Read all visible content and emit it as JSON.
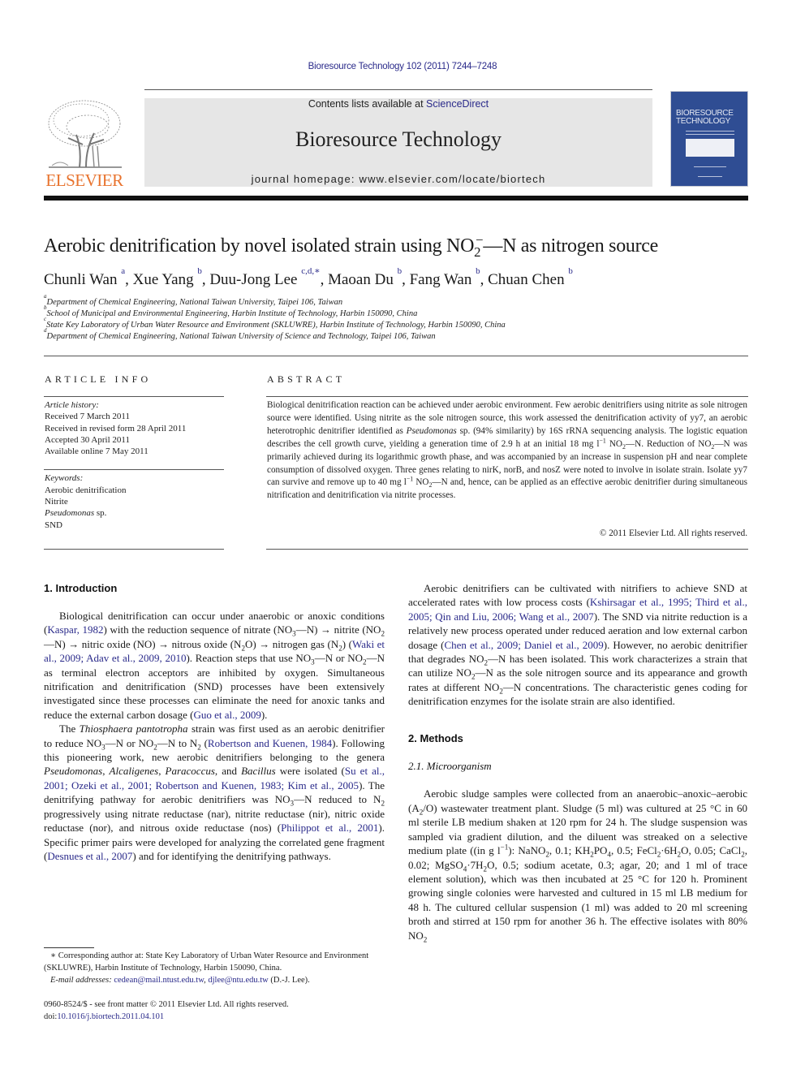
{
  "header": {
    "citation": "Bioresource Technology 102 (2011) 7244–7248",
    "contents_prefix": "Contents lists available at ",
    "contents_link": "ScienceDirect",
    "journal_name": "Bioresource Technology",
    "homepage": "journal homepage: www.elsevier.com/locate/biortech",
    "publisher_logo_text": "ELSEVIER",
    "cover_title_line1": "BIORESOURCE",
    "cover_title_line2": "TECHNOLOGY",
    "colors": {
      "publisher_orange": "#e8732e",
      "link_blue": "#2a2a8a",
      "masthead_gray": "#e6e6e6",
      "cover_blue": "#2f4d93"
    }
  },
  "article": {
    "title_pre": "Aerobic denitrification by novel isolated strain using NO",
    "title_sub": "2",
    "title_sup": "−",
    "title_post": "—N as nitrogen source",
    "authors": [
      {
        "name": "Chunli Wan",
        "aff": "a"
      },
      {
        "name": "Xue Yang",
        "aff": "b"
      },
      {
        "name": "Duu-Jong Lee",
        "aff": "c,d,∗"
      },
      {
        "name": "Maoan Du",
        "aff": "b"
      },
      {
        "name": "Fang Wan",
        "aff": "b"
      },
      {
        "name": "Chuan Chen",
        "aff": "b"
      }
    ],
    "affiliations": [
      {
        "mark": "a",
        "text": "Department of Chemical Engineering, National Taiwan University, Taipei 106, Taiwan"
      },
      {
        "mark": "b",
        "text": "School of Municipal and Environmental Engineering, Harbin Institute of Technology, Harbin 150090, China"
      },
      {
        "mark": "c",
        "text": "State Key Laboratory of Urban Water Resource and Environment (SKLUWRE), Harbin Institute of Technology, Harbin 150090, China"
      },
      {
        "mark": "d",
        "text": "Department of Chemical Engineering, National Taiwan University of Science and Technology, Taipei 106, Taiwan"
      }
    ]
  },
  "article_info": {
    "heading": "ARTICLE INFO",
    "history_label": "Article history:",
    "history": [
      "Received 7 March 2011",
      "Received in revised form 28 April 2011",
      "Accepted 30 April 2011",
      "Available online 7 May 2011"
    ],
    "keywords_label": "Keywords:",
    "keywords": [
      "Aerobic denitrification",
      "Nitrite",
      "Pseudomonas",
      "SND"
    ],
    "keyword_3_suffix": " sp."
  },
  "abstract": {
    "heading": "ABSTRACT",
    "p1": "Biological denitrification reaction can be achieved under aerobic environment. Few aerobic denitrifiers using nitrite as sole nitrogen source were identified. Using nitrite as the sole nitrogen source, this work assessed the denitrification activity of yy7, an aerobic heterotrophic denitrifier identified as ",
    "p1_italic": "Pseudomonas",
    "p2": " sp. (94% similarity) by 16S rRNA sequencing analysis. The logistic equation describes the cell growth curve, yielding a generation time of 2.9 h at an initial 18 mg l",
    "p3": " NO",
    "p4": "—N. Reduction of NO",
    "p5": "—N was primarily achieved during its logarithmic growth phase, and was accompanied by an increase in suspension pH and near complete consumption of dissolved oxygen. Three genes relating to nirK, norB, and nosZ were noted to involve in isolate strain. Isolate yy7 can survive and remove up to 40 mg l",
    "p6": " NO",
    "p7": "—N and, hence, can be applied as an effective aerobic denitrifier during simultaneous nitrification and denitrification via nitrite processes.",
    "sup_minus1": "−1",
    "sub2": "2",
    "supminus": "−",
    "copyright": "© 2011 Elsevier Ltd. All rights reserved."
  },
  "intro": {
    "heading": "1. Introduction",
    "p1": {
      "a": "Biological denitrification can occur under anaerobic or anoxic conditions (",
      "l1": "Kaspar, 1982",
      "b": ") with the reduction sequence of nitrate (NO",
      "c": "—N) → nitrite (NO",
      "d": "—N) → nitric oxide (NO) → nitrous oxide (N",
      "e": "O) → nitrogen gas (N",
      "f": ") (",
      "l2": "Waki et al., 2009; Adav et al., 2009, 2010",
      "g": "). Reaction steps that use NO",
      "h": "—N or NO",
      "i": "—N as terminal electron acceptors are inhibited by oxygen. Simultaneous nitrification and denitrification (SND) processes have been extensively investigated since these processes can eliminate the need for anoxic tanks and reduce the external carbon dosage (",
      "l3": "Guo et al., 2009",
      "j": ")."
    },
    "p2": {
      "a": "The ",
      "it1": "Thiosphaera pantotropha",
      "b": " strain was first used as an aerobic denitrifier to reduce NO",
      "c": "—N or NO",
      "d": "—N to N",
      "e": " (",
      "l1": "Robertson and Kuenen, 1984",
      "f": "). Following this pioneering work, new aerobic denitrifiers belonging to the genera ",
      "it2": "Pseudomonas",
      "g": ", ",
      "it3": "Alcaligenes",
      "h": ", ",
      "it4": "Paracoccus",
      "i": ", and ",
      "it5": "Bacillus",
      "j": " were isolated (",
      "l2": "Su et al., 2001; Ozeki et al., 2001; Robertson and Kuenen, 1983; Kim et al., 2005",
      "k": "). The denitrifying pathway for aerobic denitrifiers was NO",
      "l": "—N reduced to N",
      "m": " progressively using nitrate reductase (nar), nitrite reductase (nir), nitric oxide reductase (nor), and nitrous oxide reductase (nos) (",
      "l3": "Philippot et al., 2001",
      "n": "). Specific primer pairs were developed for analyzing the correlated gene fragment (",
      "l4": "Desnues et al., 2007",
      "o": ") and for identifying the denitrifying pathways."
    },
    "sub2": "2",
    "sub3": "3",
    "supminus": "−"
  },
  "col2": {
    "p1": {
      "a": "Aerobic denitrifiers can be cultivated with nitrifiers to achieve SND at accelerated rates with low process costs (",
      "l1": "Kshirsagar et al., 1995; Third et al., 2005; Qin and Liu, 2006; Wang et al., 2007",
      "b": "). The SND via nitrite reduction is a relatively new process operated under reduced aeration and low external carbon dosage (",
      "l2": "Chen et al., 2009; Daniel et al., 2009",
      "c": "). However, no aerobic denitrifier that degrades NO",
      "d": "—N has been isolated. This work characterizes a strain that can utilize NO",
      "e": "—N as the sole nitrogen source and its appearance and growth rates at different NO",
      "f": "—N concentrations. The characteristic genes coding for denitrification enzymes for the isolate strain are also identified."
    },
    "methods_heading": "2. Methods",
    "sub_heading": "2.1. Microorganism",
    "p2": {
      "a": "Aerobic sludge samples were collected from an anaerobic–anoxic–aerobic (A",
      "b": "/O) wastewater treatment plant. Sludge (5 ml) was cultured at 25 °C in 60 ml sterile LB medium shaken at 120 rpm for 24 h. The sludge suspension was sampled via gradient dilution, and the diluent was streaked on a selective medium plate ((in g l",
      "c": "): NaNO",
      "d": ", 0.1; KH",
      "e": "PO",
      "f": ", 0.5; FeCl",
      "g": "·6H",
      "h": "O, 0.05; CaCl",
      "i": ", 0.02; MgSO",
      "j": "·7H",
      "k": "O, 0.5; sodium acetate, 0.3; agar, 20; and 1 ml of trace element solution), which was then incubated at 25 °C for 120 h. Prominent growing single colonies were harvested and cultured in 15 ml LB medium for 48 h. The cultured cellular suspension (1 ml) was added to 20 ml screening broth and stirred at 150 rpm for another 36 h. The effective isolates with 80% NO"
    },
    "sub4": "4",
    "supm1": "−1"
  },
  "footnote": {
    "corresponding": "∗ Corresponding author at: State Key Laboratory of Urban Water Resource and Environment (SKLUWRE), Harbin Institute of Technology, Harbin 150090, China.",
    "email_label": "E-mail addresses:",
    "email1": "cedean@mail.ntust.edu.tw",
    "email2": "djlee@ntu.edu.tw",
    "email_suffix": " (D.-J. Lee).",
    "issn_line": "0960-8524/$ - see front matter © 2011 Elsevier Ltd. All rights reserved.",
    "doi_label": "doi:",
    "doi": "10.1016/j.biortech.2011.04.101"
  }
}
